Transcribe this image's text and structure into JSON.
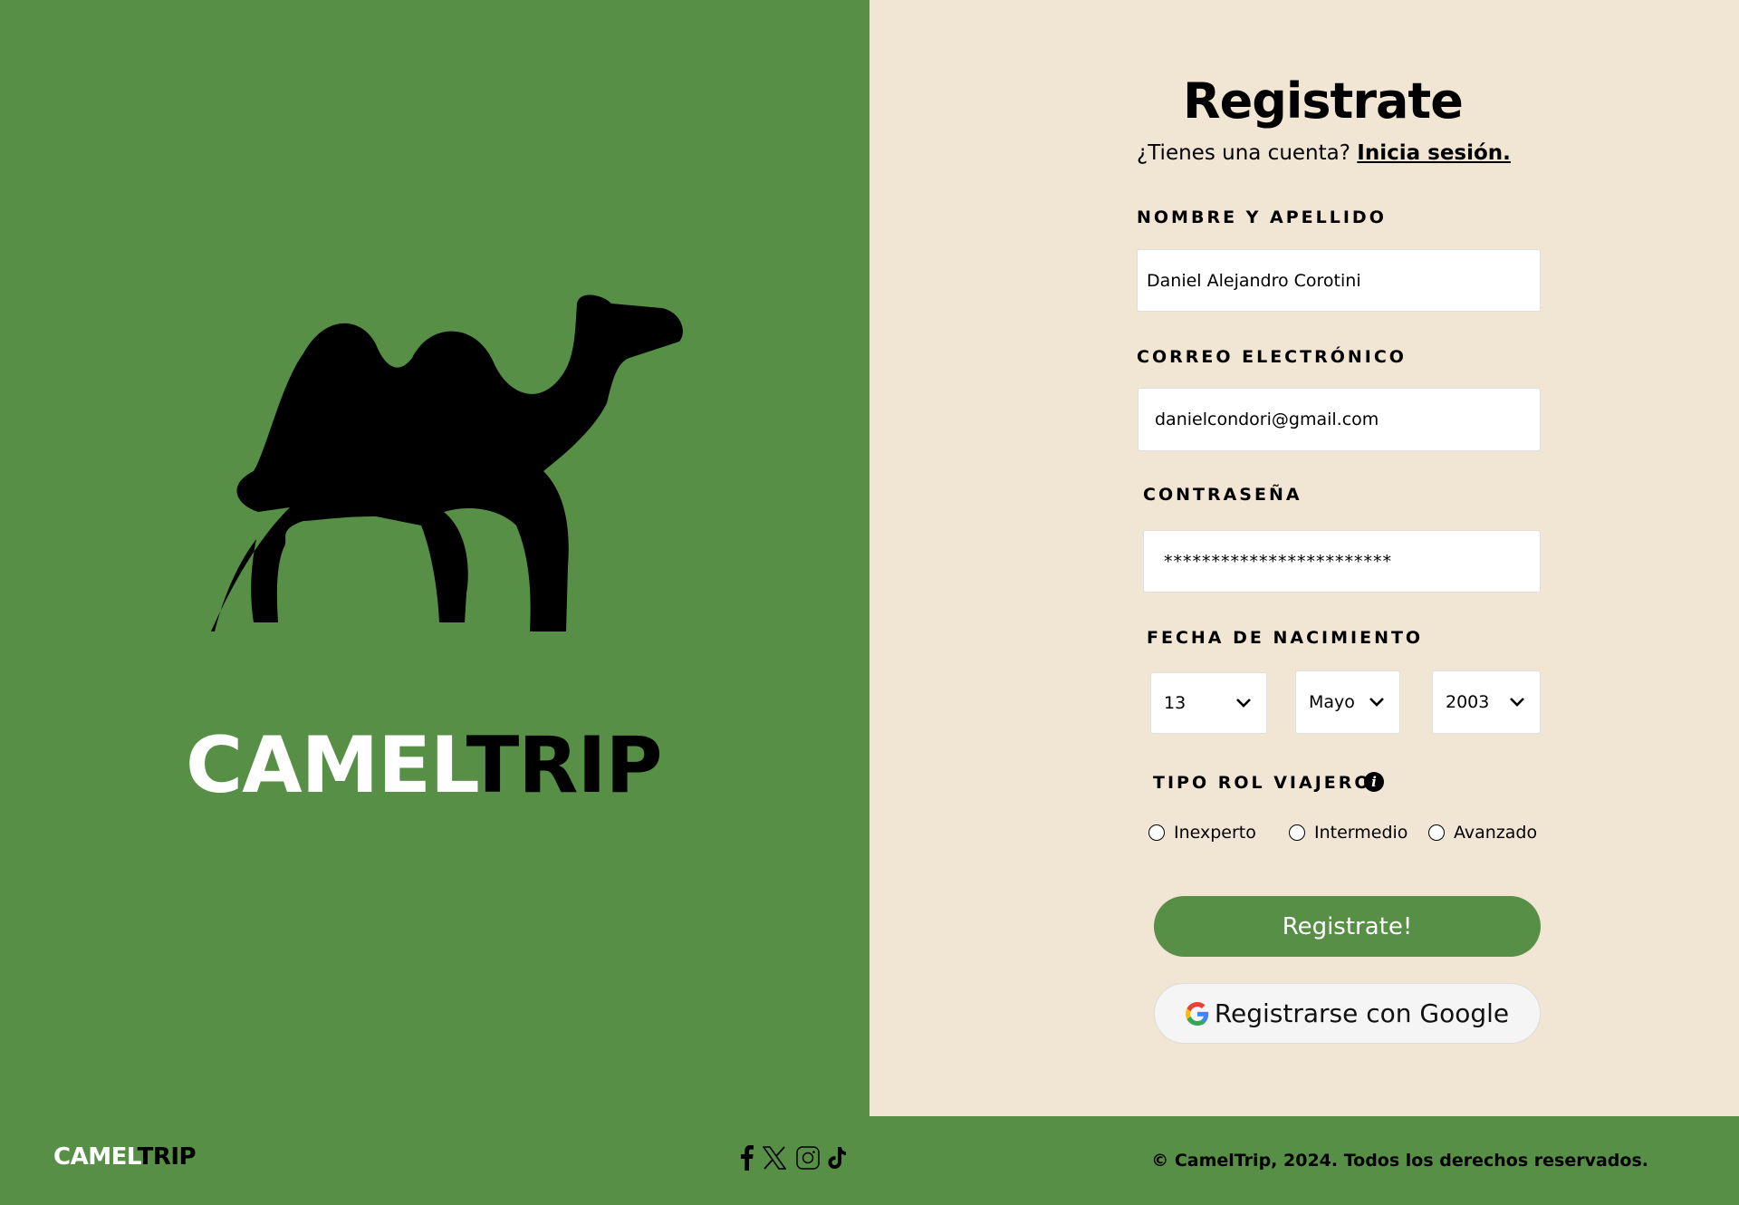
{
  "brand": {
    "part1": "CAMEL",
    "part2": "TRIP"
  },
  "form": {
    "title": "Registrate",
    "subtitle_text": "¿Tienes una cuenta?",
    "subtitle_link": "Inicia sesión.",
    "name_label": "NOMBRE Y APELLIDO",
    "name_value": "Daniel Alejandro Corotini",
    "email_label": "CORREO ELECTRÓNICO",
    "email_value": "danielcondori@gmail.com",
    "password_label": "CONTRASEÑA",
    "password_value": "************************",
    "birth_label": "FECHA DE NACIMIENTO",
    "birth_day": "13",
    "birth_month": "Mayo",
    "birth_year": "2003",
    "role_label": "TIPO ROL VIAJERO",
    "roles": [
      "Inexperto",
      "Intermedio",
      "Avanzado"
    ],
    "submit_label": "Registrate!",
    "google_label": "Registrarse con Google"
  },
  "footer": {
    "copyright": "© CamelTrip, 2024. Todos los derechos reservados.",
    "social_icons": [
      "facebook-icon",
      "x-icon",
      "instagram-icon",
      "tiktok-icon"
    ]
  },
  "colors": {
    "green": "#578f46",
    "beige": "#f1e5d3"
  }
}
